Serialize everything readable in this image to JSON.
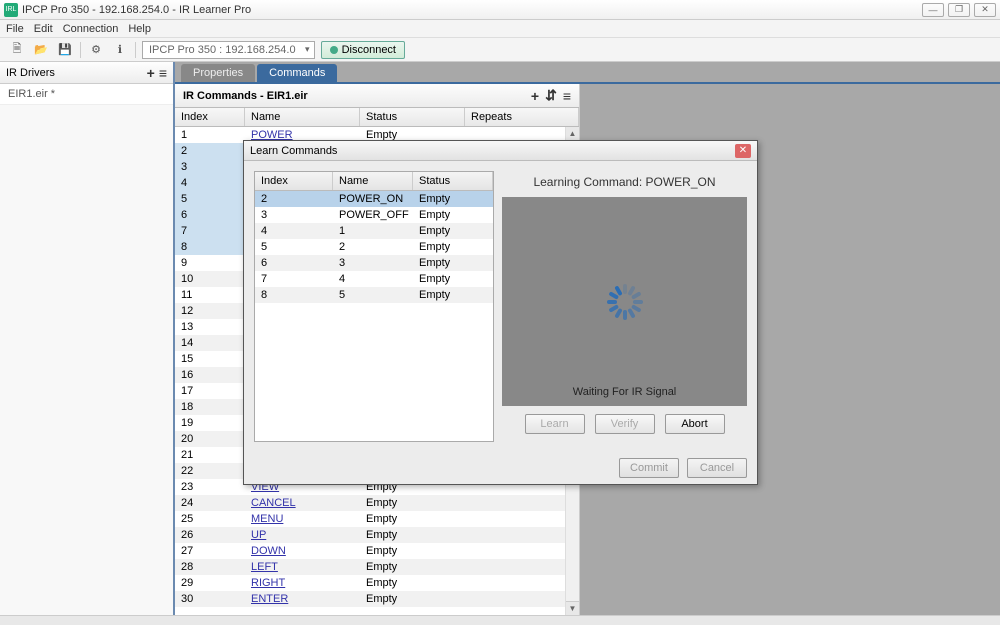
{
  "window": {
    "title": "IPCP Pro 350 - 192.168.254.0  - IR Learner Pro",
    "min": "—",
    "max": "❐",
    "close": "✕"
  },
  "menu": {
    "file": "File",
    "edit": "Edit",
    "connection": "Connection",
    "help": "Help"
  },
  "toolbar": {
    "device": "IPCP Pro 350 : 192.168.254.0",
    "disconnect": "Disconnect"
  },
  "left": {
    "header": "IR Drivers",
    "plus": "+",
    "menu": "≡",
    "items": [
      {
        "label": "EIR1.eir *"
      }
    ]
  },
  "tabs": {
    "properties": "Properties",
    "commands": "Commands"
  },
  "cmdPanel": {
    "title_prefix": "IR Commands - ",
    "title_file": "EIR1.eir",
    "plus": "+",
    "wand": "⇵",
    "menu": "≡",
    "headers": {
      "index": "Index",
      "name": "Name",
      "status": "Status",
      "repeats": "Repeats"
    },
    "rows": [
      {
        "i": "1",
        "n": "POWER",
        "s": "Empty",
        "link": true
      },
      {
        "i": "2",
        "n": "",
        "s": "",
        "sel": true
      },
      {
        "i": "3",
        "n": "",
        "s": "",
        "sel": true
      },
      {
        "i": "4",
        "n": "",
        "s": "",
        "sel": true
      },
      {
        "i": "5",
        "n": "",
        "s": "",
        "sel": true
      },
      {
        "i": "6",
        "n": "",
        "s": "",
        "sel": true
      },
      {
        "i": "7",
        "n": "",
        "s": "",
        "sel": true
      },
      {
        "i": "8",
        "n": "",
        "s": "",
        "sel": true
      },
      {
        "i": "9",
        "n": "",
        "s": ""
      },
      {
        "i": "10",
        "n": "",
        "s": ""
      },
      {
        "i": "11",
        "n": "",
        "s": ""
      },
      {
        "i": "12",
        "n": "",
        "s": ""
      },
      {
        "i": "13",
        "n": "",
        "s": ""
      },
      {
        "i": "14",
        "n": "",
        "s": ""
      },
      {
        "i": "15",
        "n": "",
        "s": ""
      },
      {
        "i": "16",
        "n": "",
        "s": ""
      },
      {
        "i": "17",
        "n": "",
        "s": ""
      },
      {
        "i": "18",
        "n": "",
        "s": ""
      },
      {
        "i": "19",
        "n": "",
        "s": ""
      },
      {
        "i": "20",
        "n": "",
        "s": ""
      },
      {
        "i": "21",
        "n": "",
        "s": ""
      },
      {
        "i": "22",
        "n": "",
        "s": ""
      },
      {
        "i": "23",
        "n": "VIEW",
        "s": "Empty",
        "link": true
      },
      {
        "i": "24",
        "n": "CANCEL",
        "s": "Empty",
        "link": true
      },
      {
        "i": "25",
        "n": "MENU",
        "s": "Empty",
        "link": true
      },
      {
        "i": "26",
        "n": "UP",
        "s": "Empty",
        "link": true
      },
      {
        "i": "27",
        "n": "DOWN",
        "s": "Empty",
        "link": true
      },
      {
        "i": "28",
        "n": "LEFT",
        "s": "Empty",
        "link": true
      },
      {
        "i": "29",
        "n": "RIGHT",
        "s": "Empty",
        "link": true
      },
      {
        "i": "30",
        "n": "ENTER",
        "s": "Empty",
        "link": true
      }
    ]
  },
  "modal": {
    "title": "Learn Commands",
    "headers": {
      "index": "Index",
      "name": "Name",
      "status": "Status"
    },
    "rows": [
      {
        "i": "2",
        "n": "POWER_ON",
        "s": "Empty",
        "sel": true
      },
      {
        "i": "3",
        "n": "POWER_OFF",
        "s": "Empty"
      },
      {
        "i": "4",
        "n": "1",
        "s": "Empty"
      },
      {
        "i": "5",
        "n": "2",
        "s": "Empty"
      },
      {
        "i": "6",
        "n": "3",
        "s": "Empty"
      },
      {
        "i": "7",
        "n": "4",
        "s": "Empty"
      },
      {
        "i": "8",
        "n": "5",
        "s": "Empty"
      }
    ],
    "learning_label": "Learning Command: POWER_ON",
    "waiting": "Waiting For IR Signal",
    "btn_learn": "Learn",
    "btn_verify": "Verify",
    "btn_abort": "Abort",
    "btn_commit": "Commit",
    "btn_cancel": "Cancel"
  }
}
